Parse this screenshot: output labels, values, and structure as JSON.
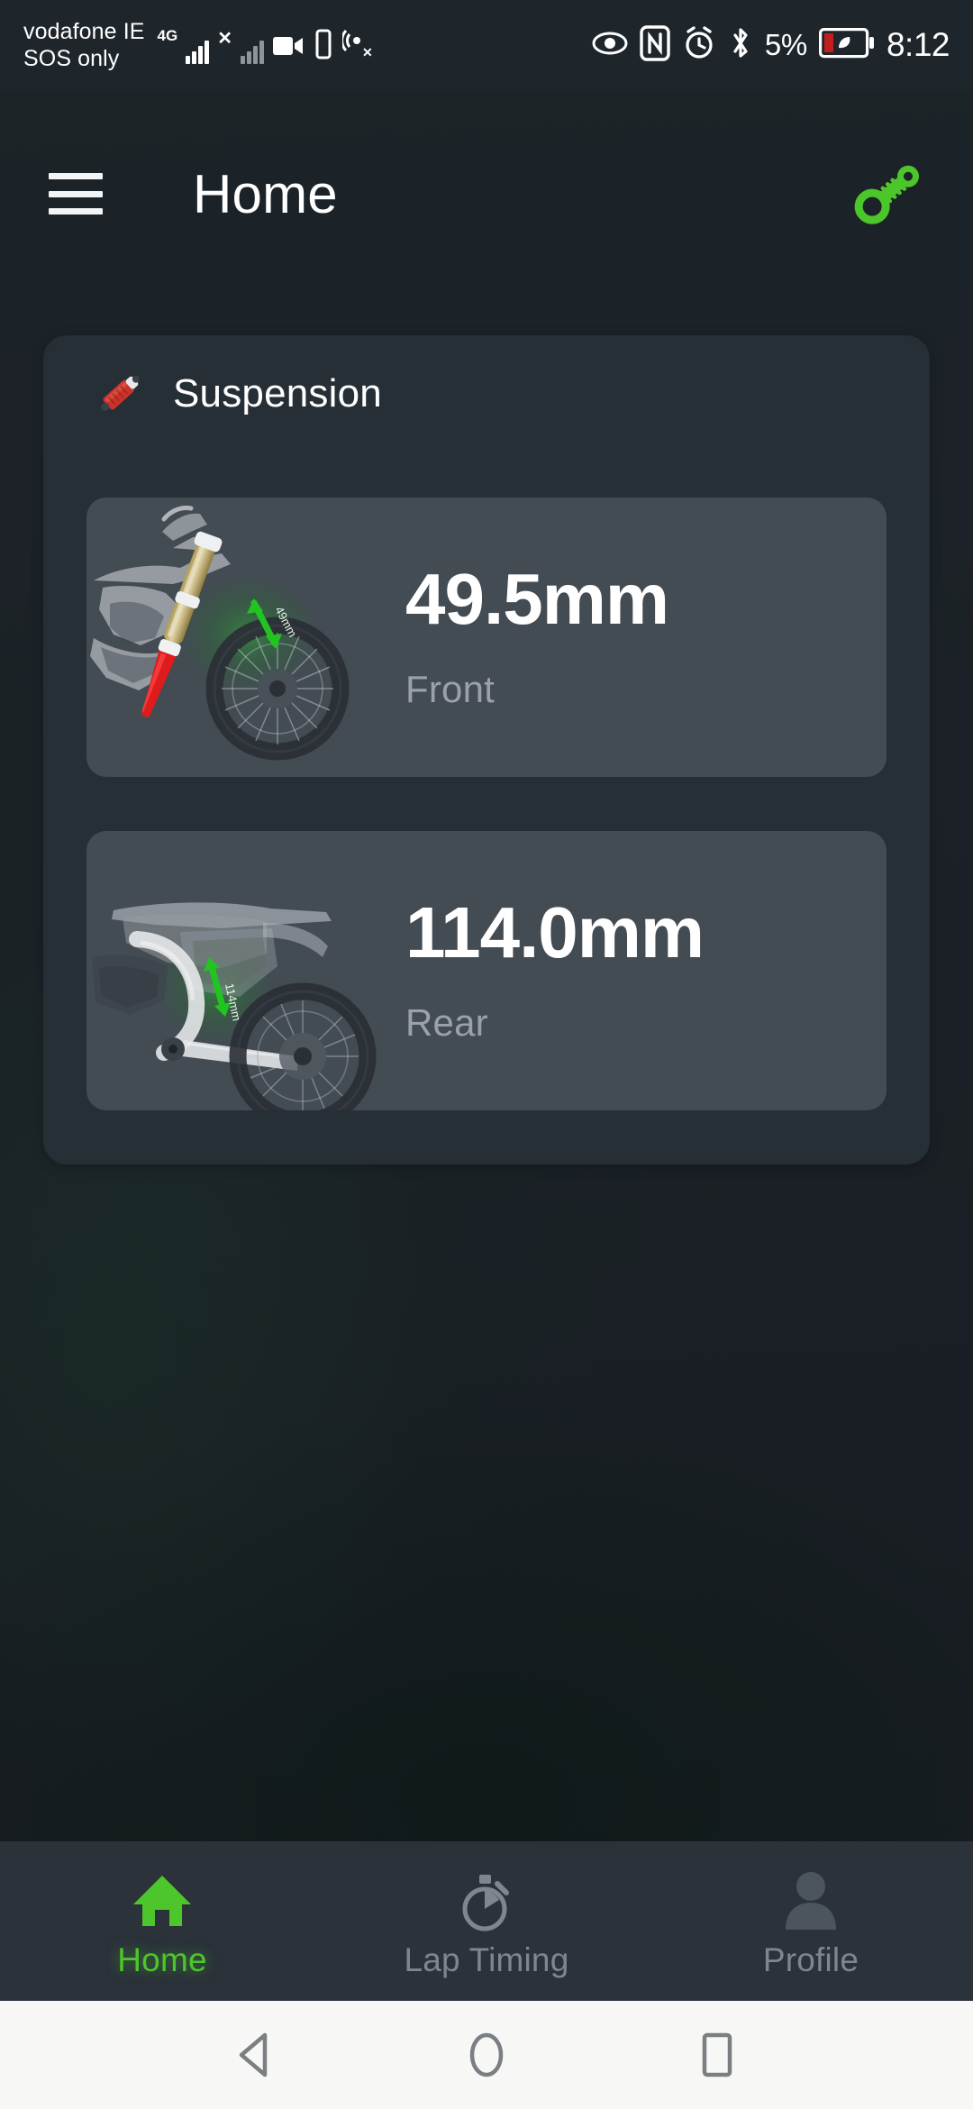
{
  "status_bar": {
    "carrier_line1": "vodafone IE",
    "carrier_line2": "SOS only",
    "network_type": "4G",
    "signal_strength_icon": "signal-bars-icon",
    "signal_secondary_icon": "signal-bars-no-service-icon",
    "screen_record_icon": "video-camera-icon",
    "vibrate_icon": "vibrate-icon",
    "location_off_icon": "location-off-icon",
    "eye_comfort_icon": "eye-icon",
    "nfc_icon": "nfc-icon",
    "alarm_icon": "alarm-clock-icon",
    "bluetooth_icon": "bluetooth-icon",
    "battery_percent": "5%",
    "battery_icon": "battery-power-saving-icon",
    "time": "8:12"
  },
  "app_bar": {
    "menu_icon": "hamburger-menu-icon",
    "title": "Home",
    "action_icon": "shock-absorber-connected-icon",
    "action_color": "#4cc62b"
  },
  "suspension_card": {
    "icon": "shock-absorber-icon",
    "icon_color": "#c8342a",
    "title": "Suspension",
    "metrics": [
      {
        "value": "49.5mm",
        "label": "Front",
        "image": "dirt-bike-front-fork-illustration",
        "arrow_label": "49mm",
        "highlight_color": "#22c422",
        "travel_color": "#e01b1b"
      },
      {
        "value": "114.0mm",
        "label": "Rear",
        "image": "dirt-bike-rear-shock-illustration",
        "arrow_label": "114mm",
        "highlight_color": "#22c422",
        "travel_color": "#e01b1b"
      }
    ]
  },
  "bottom_nav": {
    "items": [
      {
        "label": "Home",
        "icon": "home-icon",
        "active": true
      },
      {
        "label": "Lap Timing",
        "icon": "stopwatch-icon",
        "active": false
      },
      {
        "label": "Profile",
        "icon": "person-icon",
        "active": false
      }
    ],
    "active_color": "#4cc62b",
    "inactive_color": "#7e868e"
  },
  "android_nav": {
    "back_icon": "back-triangle-icon",
    "home_icon": "home-circle-icon",
    "recents_icon": "recents-square-icon"
  }
}
